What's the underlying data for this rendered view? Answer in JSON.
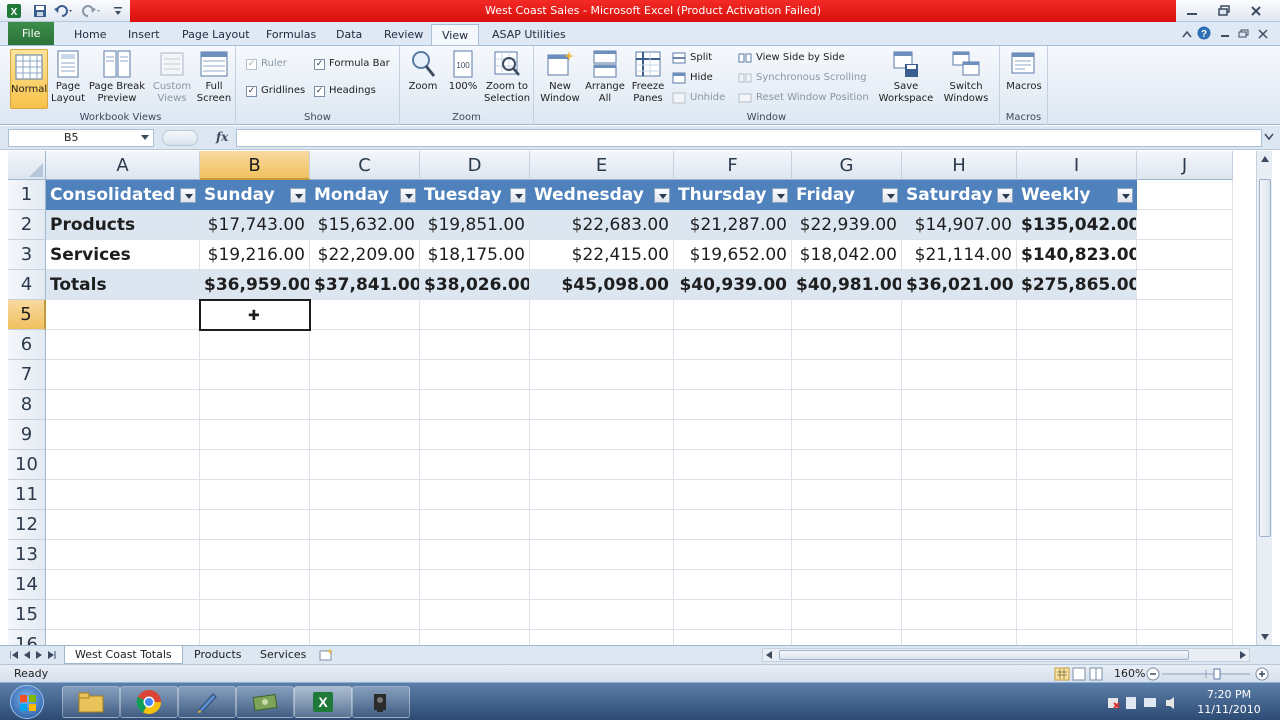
{
  "window": {
    "title": "West Coast Sales  -  Microsoft Excel (Product Activation Failed)"
  },
  "ribbon_tabs": [
    "File",
    "Home",
    "Insert",
    "Page Layout",
    "Formulas",
    "Data",
    "Review",
    "View",
    "ASAP Utilities"
  ],
  "active_tab": "View",
  "ribbon": {
    "workbook_views": {
      "label": "Workbook Views",
      "normal": "Normal",
      "page_layout": "Page\nLayout",
      "page_break": "Page Break\nPreview",
      "custom_views": "Custom\nViews",
      "full_screen": "Full\nScreen"
    },
    "show": {
      "label": "Show",
      "ruler": "Ruler",
      "formula_bar": "Formula Bar",
      "gridlines": "Gridlines",
      "headings": "Headings"
    },
    "zoom": {
      "label": "Zoom",
      "zoom": "Zoom",
      "hundred": "100%",
      "zoom_to_selection": "Zoom to\nSelection"
    },
    "window": {
      "label": "Window",
      "new_window": "New\nWindow",
      "arrange_all": "Arrange\nAll",
      "freeze_panes": "Freeze\nPanes",
      "split": "Split",
      "hide": "Hide",
      "unhide": "Unhide",
      "view_side_by_side": "View Side by Side",
      "synchronous_scrolling": "Synchronous Scrolling",
      "reset_window_position": "Reset Window Position",
      "save_workspace": "Save\nWorkspace",
      "switch_windows": "Switch\nWindows"
    },
    "macros": {
      "label": "Macros",
      "macros": "Macros"
    }
  },
  "formula_bar": {
    "name_box": "B5",
    "fx": "fx",
    "content": ""
  },
  "columns": [
    "A",
    "B",
    "C",
    "D",
    "E",
    "F",
    "G",
    "H",
    "I",
    "J"
  ],
  "selected_column": "B",
  "rows": [
    "1",
    "2",
    "3",
    "4",
    "5",
    "6",
    "7",
    "8",
    "9",
    "10",
    "11",
    "12",
    "13",
    "14",
    "15",
    "16"
  ],
  "selected_row": "5",
  "table": {
    "headers": [
      "Consolidated",
      "Sunday",
      "Monday",
      "Tuesday",
      "Wednesday",
      "Thursday",
      "Friday",
      "Saturday",
      "Weekly"
    ],
    "data": [
      [
        "Products",
        "$17,743.00",
        "$15,632.00",
        "$19,851.00",
        "$22,683.00",
        "$21,287.00",
        "$22,939.00",
        "$14,907.00",
        "$135,042.00"
      ],
      [
        "Services",
        "$19,216.00",
        "$22,209.00",
        "$18,175.00",
        "$22,415.00",
        "$19,652.00",
        "$18,042.00",
        "$21,114.00",
        "$140,823.00"
      ],
      [
        "Totals",
        "$36,959.00",
        "$37,841.00",
        "$38,026.00",
        "$45,098.00",
        "$40,939.00",
        "$40,981.00",
        "$36,021.00",
        "$275,865.00"
      ]
    ]
  },
  "sheets": [
    "West Coast Totals",
    "Products",
    "Services"
  ],
  "active_sheet": "West Coast Totals",
  "status": {
    "mode": "Ready",
    "zoom": "160%"
  },
  "clock": {
    "time": "7:20 PM",
    "date": "11/11/2010"
  },
  "colors": {
    "table_header": "#4f81bd",
    "band": "#dce6f1",
    "title_band": "#e81b17",
    "accent_file": "#2f7a3d"
  }
}
